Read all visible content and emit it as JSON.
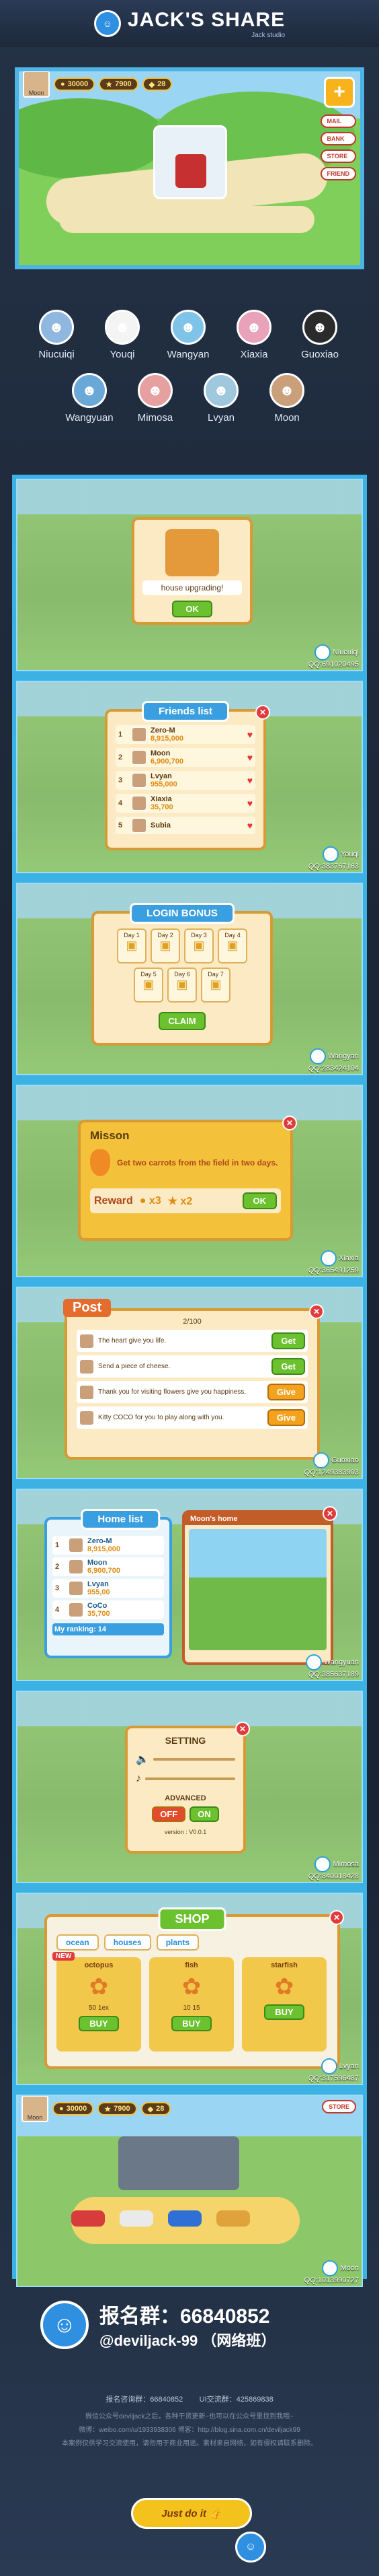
{
  "header": {
    "title": "JACK'S SHARE",
    "subtitle": "Jack studio",
    "logo": "Jack"
  },
  "hero": {
    "player": "Moon",
    "coins": "30000",
    "stars": "7900",
    "gems": "28",
    "labels": [
      "MAIL",
      "BANK",
      "STORE",
      "FRIEND"
    ]
  },
  "friends": [
    {
      "name": "Niucuiqi",
      "icon": "wolf-face",
      "color": "#8fb7e0"
    },
    {
      "name": "Youqi",
      "icon": "rabbit-face",
      "color": "#f4f4f4"
    },
    {
      "name": "Wangyan",
      "icon": "girl-face",
      "color": "#7fc3e8"
    },
    {
      "name": "Xiaxia",
      "icon": "girl-face",
      "color": "#e8a2b9"
    },
    {
      "name": "Guoxiao",
      "icon": "dark-face",
      "color": "#2b2b2b"
    },
    {
      "name": "Wangyuan",
      "icon": "boy-face",
      "color": "#6aa8d8"
    },
    {
      "name": "Mimosa",
      "icon": "girl-face",
      "color": "#e7a0a0"
    },
    {
      "name": "Lvyan",
      "icon": "bird-face",
      "color": "#9fc8df"
    },
    {
      "name": "Moon",
      "icon": "cat-face",
      "color": "#c9a07a"
    }
  ],
  "screens": {
    "upgrade": {
      "message": "house upgrading!",
      "ok": "OK",
      "credit_name": "Niucuiqi",
      "credit_qq": "QQ:691020495"
    },
    "friends_list": {
      "title": "Friends list",
      "rows": [
        {
          "rank": "1",
          "name": "Zero-M",
          "score": "8,915,000"
        },
        {
          "rank": "2",
          "name": "Moon",
          "score": "6,900,700"
        },
        {
          "rank": "3",
          "name": "Lvyan",
          "score": "955,000"
        },
        {
          "rank": "4",
          "name": "Xiaxia",
          "score": "35,700"
        },
        {
          "rank": "5",
          "name": "Subia",
          "score": ""
        }
      ],
      "credit_name": "Youqi",
      "credit_qq": "QQ:383767163"
    },
    "login_bonus": {
      "title": "LOGIN BONUS",
      "days": [
        "Day 1",
        "Day 2",
        "Day 3",
        "Day 4",
        "Day 5",
        "Day 6",
        "Day 7"
      ],
      "claim": "CLAIM",
      "credit_name": "Wangyan",
      "credit_qq": "QQ:283424104"
    },
    "mission": {
      "title": "Misson",
      "text": "Get two carrots from the field in two days.",
      "reward_label": "Reward",
      "reward_coins": "x3",
      "reward_stars": "x2",
      "ok": "OK",
      "credit_name": "Xiaxia",
      "credit_qq": "QQ:365491259"
    },
    "post": {
      "title": "Post",
      "count": "2/100",
      "rows": [
        {
          "text": "The heart give you life.",
          "action": "Get"
        },
        {
          "text": "Send a piece of cheese.",
          "action": "Get"
        },
        {
          "text": "Thank you for visiting flowers give you happiness.",
          "action": "Give"
        },
        {
          "text": "Kitty COCO for you to play along with you.",
          "action": "Give"
        }
      ],
      "credit_name": "Guoxiao",
      "credit_qq": "QQ:1249383903"
    },
    "home_list": {
      "title": "Home list",
      "rows": [
        {
          "rank": "1",
          "name": "Zero-M",
          "score": "8,915,000"
        },
        {
          "rank": "2",
          "name": "Moon",
          "score": "6,900,700"
        },
        {
          "rank": "3",
          "name": "Lvyan",
          "score": "955,00"
        },
        {
          "rank": "4",
          "name": "CoCo",
          "score": "35,700"
        }
      ],
      "my_ranking": "My ranking: 14",
      "home_title": "Moon's home",
      "credit_name": "Wangyuan",
      "credit_qq": "QQ:385637189"
    },
    "setting": {
      "title": "SETTING",
      "advanced": "ADVANCED",
      "off": "OFF",
      "on": "ON",
      "version": "version : V0.0.1",
      "credit_name": "Mimosa",
      "credit_qq": "QQ:840018428"
    },
    "shop": {
      "title": "SHOP",
      "tabs": [
        "ocean",
        "houses",
        "plants"
      ],
      "items": [
        {
          "name": "octopus",
          "badge": "NEW",
          "buy": "BUY",
          "stat1": "50",
          "stat2": "1ex"
        },
        {
          "name": "fish",
          "buy": "BUY",
          "stat1": "10",
          "stat2": "15"
        },
        {
          "name": "starfish",
          "buy": "BUY",
          "stat1": "",
          "stat2": ""
        }
      ],
      "credit_name": "Lvyan",
      "credit_qq": "QQ:317596487"
    },
    "garage": {
      "player": "Moon",
      "coins": "30000",
      "stars": "7900",
      "gems": "28",
      "label": "STORE",
      "credit_name": "Moon",
      "credit_qq": "QQ:1013990727"
    }
  },
  "footer": {
    "group_label": "报名群：66840852",
    "handle": "@deviljack-99 （网络班）",
    "line1_a": "报名咨询群：66840852",
    "line1_b": "UI交流群：425869838",
    "note1": "微信公众号deviljack之后，各种干货更新~也可以在公众号里找到我哦~",
    "note2": "微博：weibo.com/u/1933938306    博客：http://blog.sina.com.cn/deviljack99",
    "note3": "本案例仅供学习交流使用，请勿用于商业用途。素材来自网络，如有侵权请联系删除。",
    "just_do_it": "Just do it",
    "colors": {
      "accent": "#3cb1e4",
      "gold": "#f4c21d",
      "bg": "#1f2a3a"
    }
  }
}
